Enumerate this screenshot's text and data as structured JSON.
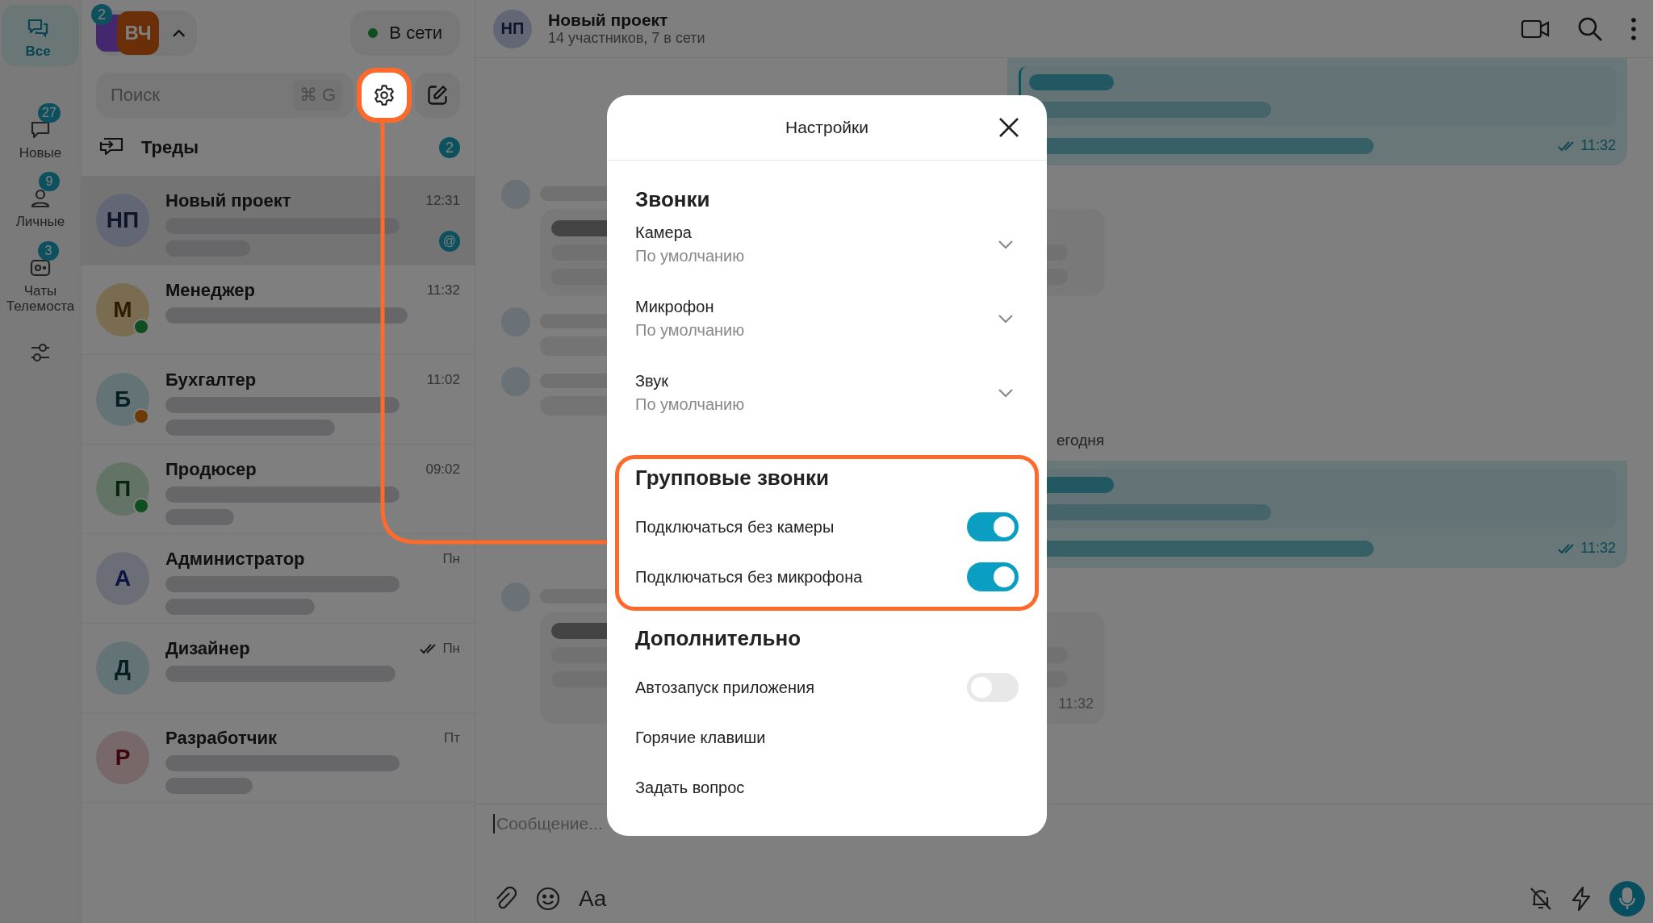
{
  "rail": [
    {
      "label": "Все",
      "selected": true
    },
    {
      "label": "Новые",
      "badge": "27",
      "selected": false
    },
    {
      "label": "Личные",
      "badge": "9",
      "selected": false
    },
    {
      "label": "Чаты Телемоста",
      "badge": "3",
      "selected": false
    },
    {
      "selected": false
    }
  ],
  "accounts": {
    "badge": "2",
    "initials": "ВЧ",
    "status": "В сети"
  },
  "search": {
    "placeholder": "Поиск",
    "shortcut": "⌘ G",
    "settings_highlighted": true
  },
  "threads": {
    "label": "Треды",
    "count": "2"
  },
  "chats": [
    {
      "name": "Новый проект",
      "initials": "НП",
      "time": "12:31",
      "online": false,
      "away": false,
      "mention": "@",
      "read": false,
      "selected": true
    },
    {
      "name": "Менеджер",
      "initials": "М",
      "time": "11:32",
      "online": true,
      "away": false,
      "read": false,
      "selected": false
    },
    {
      "name": "Бухгалтер",
      "initials": "Б",
      "time": "11:02",
      "online": false,
      "away": true,
      "read": false,
      "selected": false
    },
    {
      "name": "Продюсер",
      "initials": "П",
      "time": "09:02",
      "online": true,
      "away": false,
      "read": false,
      "selected": false
    },
    {
      "name": "Администратор",
      "initials": "А",
      "time": "Пн",
      "online": false,
      "away": false,
      "read": false,
      "selected": false
    },
    {
      "name": "Дизайнер",
      "initials": "Д",
      "time": "Пн",
      "online": false,
      "away": false,
      "read": true,
      "selected": false
    },
    {
      "name": "Разработчик",
      "initials": "Р",
      "time": "Пт",
      "online": false,
      "away": false,
      "read": false,
      "selected": false
    }
  ],
  "chat_header": {
    "initials": "НП",
    "title": "Новый проект",
    "subtitle": "14 участников, 7 в сети"
  },
  "date_divider": "егодня",
  "messages": [
    {
      "kind": "outgoing",
      "time": "11:32"
    },
    {
      "kind": "incoming"
    },
    {
      "kind": "incoming_short"
    },
    {
      "kind": "incoming_short"
    },
    {
      "kind": "date"
    },
    {
      "kind": "outgoing",
      "time": "11:32"
    },
    {
      "kind": "incoming",
      "time": "11:32"
    }
  ],
  "composer": {
    "placeholder": "Сообщение...",
    "format": "Aa"
  },
  "settings": {
    "title": "Настройки",
    "sections": [
      {
        "title": "Звонки",
        "highlighted": false,
        "items": [
          {
            "kind": "select",
            "label": "Камера",
            "value": "По умолчанию"
          },
          {
            "kind": "select",
            "label": "Микрофон",
            "value": "По умолчанию"
          },
          {
            "kind": "select",
            "label": "Звук",
            "value": "По умолчанию"
          }
        ]
      },
      {
        "title": "Групповые звонки",
        "highlighted": true,
        "items": [
          {
            "kind": "toggle",
            "label": "Подключаться без камеры",
            "on": true
          },
          {
            "kind": "toggle",
            "label": "Подключаться без микрофона",
            "on": true
          }
        ]
      },
      {
        "title": "Дополнительно",
        "highlighted": false,
        "items": [
          {
            "kind": "toggle",
            "label": "Автозапуск приложения",
            "on": false
          },
          {
            "kind": "link",
            "label": "Горячие клавиши"
          },
          {
            "kind": "link",
            "label": "Задать вопрос"
          }
        ]
      }
    ]
  }
}
